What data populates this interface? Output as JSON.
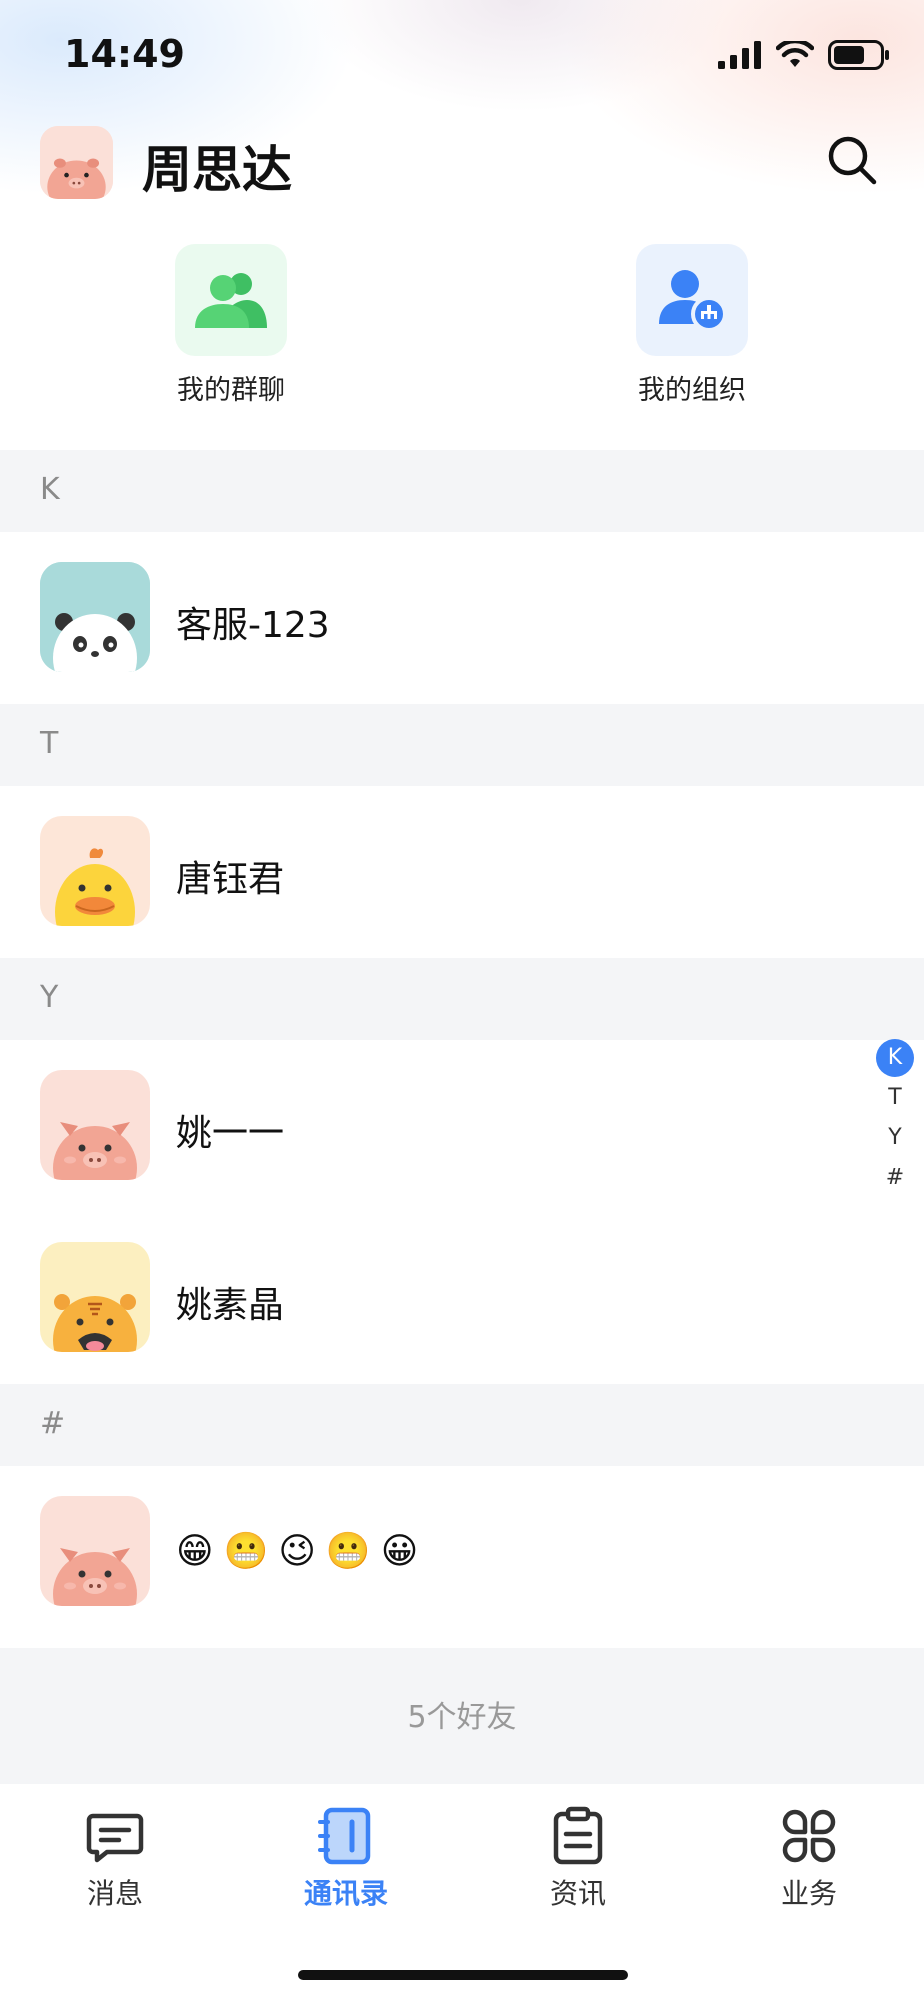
{
  "status_bar": {
    "time": "14:49"
  },
  "header": {
    "title": "周思达"
  },
  "shortcuts": [
    {
      "label": "我的群聊"
    },
    {
      "label": "我的组织"
    }
  ],
  "sections": [
    {
      "letter": "K",
      "contacts": [
        {
          "name": "客服-123",
          "avatar": "panda-avatar"
        }
      ]
    },
    {
      "letter": "T",
      "contacts": [
        {
          "name": "唐钰君",
          "avatar": "chick-avatar"
        }
      ]
    },
    {
      "letter": "Y",
      "contacts": [
        {
          "name": "姚一一",
          "avatar": "pig-avatar"
        },
        {
          "name": "姚素晶",
          "avatar": "tiger-avatar"
        }
      ]
    },
    {
      "letter": "#",
      "contacts": [
        {
          "name": "😁😬😉😬😀",
          "avatar": "pig-avatar"
        }
      ]
    }
  ],
  "index_bar": [
    "K",
    "T",
    "Y",
    "#"
  ],
  "friend_count": "5个好友",
  "tabbar": [
    {
      "label": "消息",
      "icon": "message-icon",
      "active": false
    },
    {
      "label": "通讯录",
      "icon": "contacts-book-icon",
      "active": true
    },
    {
      "label": "资讯",
      "icon": "clipboard-icon",
      "active": false
    },
    {
      "label": "业务",
      "icon": "grid-clover-icon",
      "active": false
    }
  ],
  "colors": {
    "accent": "#3b82f6",
    "group_green": "#4cc46a",
    "section_bg": "#f4f5f7"
  }
}
